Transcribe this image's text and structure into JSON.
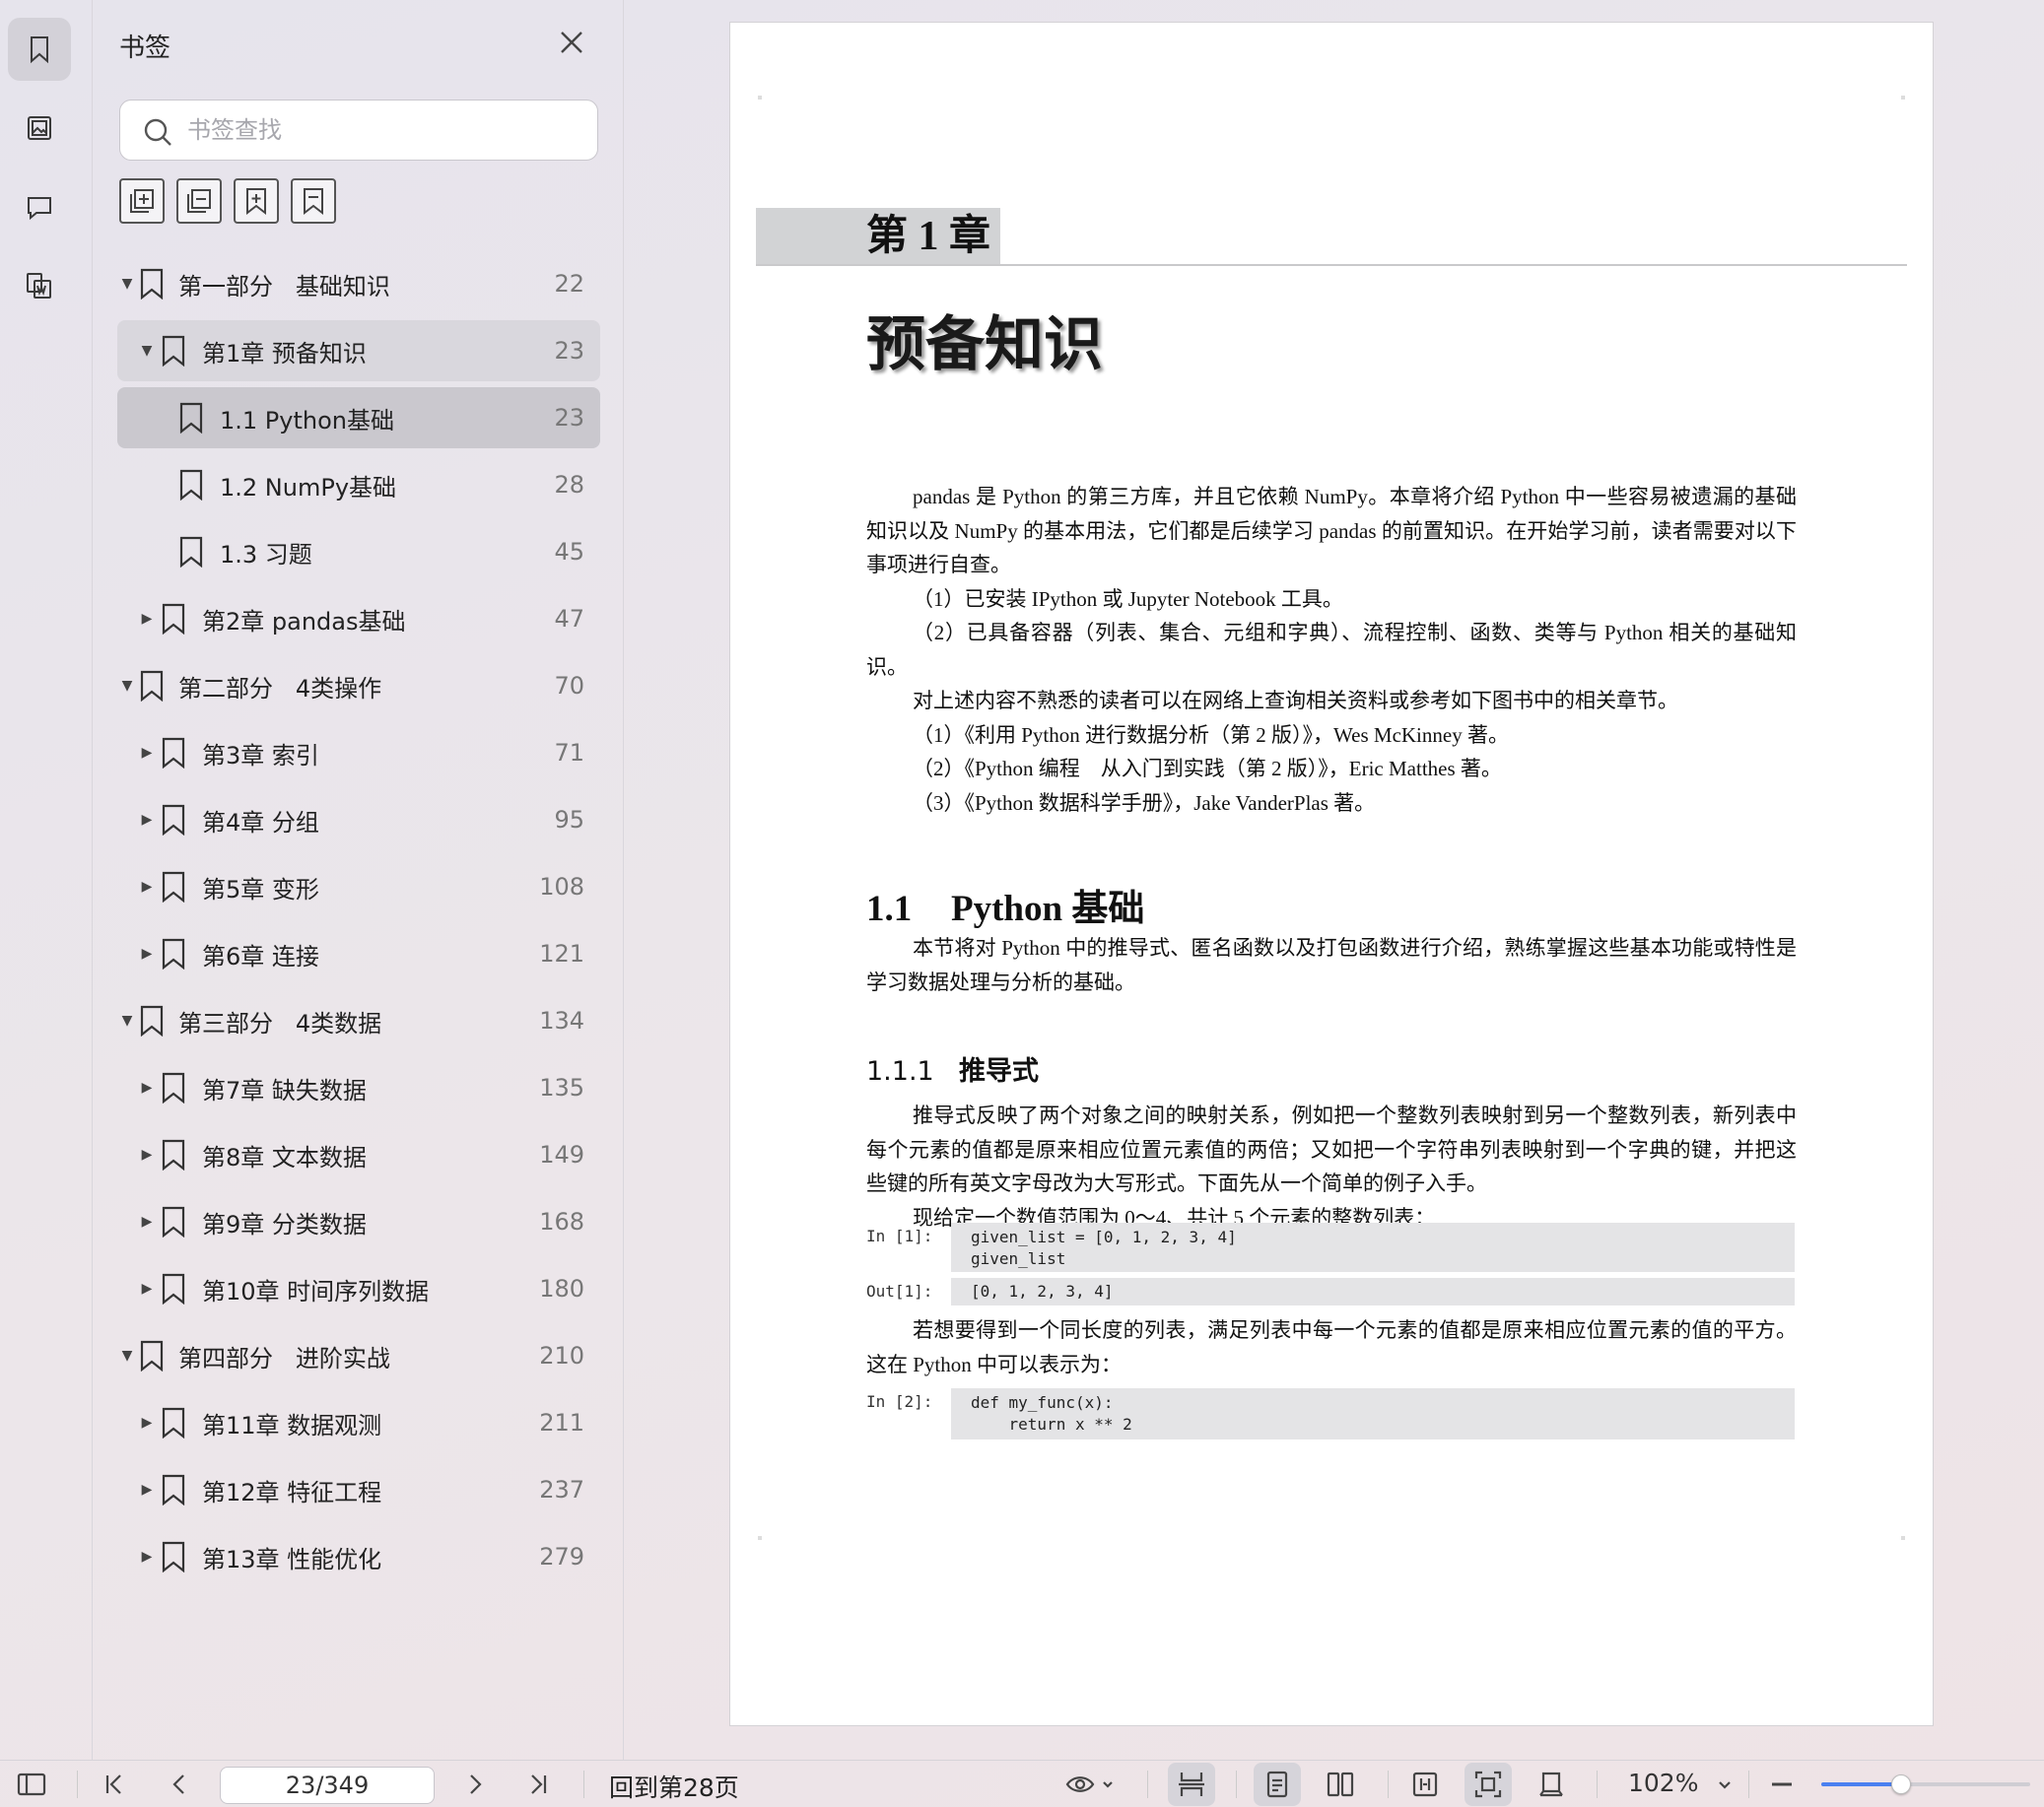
{
  "sidebar_panel": {
    "title": "书签",
    "search_placeholder": "书签查找",
    "bookmarks": [
      {
        "label": "第一部分   基础知识",
        "page": "22",
        "level": 0,
        "expanded": true,
        "state": ""
      },
      {
        "label": "第1章 预备知识",
        "page": "23",
        "level": 1,
        "expanded": true,
        "state": "sel1"
      },
      {
        "label": "1.1 Python基础",
        "page": "23",
        "level": 2,
        "expanded": null,
        "state": "sel2"
      },
      {
        "label": "1.2 NumPy基础",
        "page": "28",
        "level": 2,
        "expanded": null,
        "state": ""
      },
      {
        "label": "1.3 习题",
        "page": "45",
        "level": 2,
        "expanded": null,
        "state": ""
      },
      {
        "label": "第2章 pandas基础",
        "page": "47",
        "level": 1,
        "expanded": false,
        "state": ""
      },
      {
        "label": "第二部分   4类操作",
        "page": "70",
        "level": 0,
        "expanded": true,
        "state": ""
      },
      {
        "label": "第3章 索引",
        "page": "71",
        "level": 1,
        "expanded": false,
        "state": ""
      },
      {
        "label": "第4章 分组",
        "page": "95",
        "level": 1,
        "expanded": false,
        "state": ""
      },
      {
        "label": "第5章 变形",
        "page": "108",
        "level": 1,
        "expanded": false,
        "state": ""
      },
      {
        "label": "第6章 连接",
        "page": "121",
        "level": 1,
        "expanded": false,
        "state": ""
      },
      {
        "label": "第三部分   4类数据",
        "page": "134",
        "level": 0,
        "expanded": true,
        "state": ""
      },
      {
        "label": "第7章 缺失数据",
        "page": "135",
        "level": 1,
        "expanded": false,
        "state": ""
      },
      {
        "label": "第8章 文本数据",
        "page": "149",
        "level": 1,
        "expanded": false,
        "state": ""
      },
      {
        "label": "第9章 分类数据",
        "page": "168",
        "level": 1,
        "expanded": false,
        "state": ""
      },
      {
        "label": "第10章 时间序列数据",
        "page": "180",
        "level": 1,
        "expanded": false,
        "state": ""
      },
      {
        "label": "第四部分   进阶实战",
        "page": "210",
        "level": 0,
        "expanded": true,
        "state": ""
      },
      {
        "label": "第11章 数据观测",
        "page": "211",
        "level": 1,
        "expanded": false,
        "state": ""
      },
      {
        "label": "第12章 特征工程",
        "page": "237",
        "level": 1,
        "expanded": false,
        "state": ""
      },
      {
        "label": "第13章 性能优化",
        "page": "279",
        "level": 1,
        "expanded": false,
        "state": ""
      }
    ]
  },
  "document": {
    "chapter_num": "第 1 章",
    "chapter_title": "预备知识",
    "intro": [
      "pandas 是 Python 的第三方库，并且它依赖 NumPy。本章将介绍 Python 中一些容易被遗漏的基础知识以及 NumPy 的基本用法，它们都是后续学习 pandas 的前置知识。在开始学习前，读者需要对以下事项进行自查。",
      "（1）已安装 IPython 或 Jupyter Notebook 工具。",
      "（2）已具备容器（列表、集合、元组和字典）、流程控制、函数、类等与 Python 相关的基础知识。",
      "对上述内容不熟悉的读者可以在网络上查询相关资料或参考如下图书中的相关章节。",
      "（1）《利用 Python 进行数据分析（第 2 版）》，Wes McKinney 著。",
      "（2）《Python 编程　从入门到实践（第 2 版）》，Eric Matthes 著。",
      "（3）《Python 数据科学手册》，Jake VanderPlas 著。"
    ],
    "sec1_num": "1.1",
    "sec1_title": "Python 基础",
    "sec1_para": "本节将对 Python 中的推导式、匿名函数以及打包函数进行介绍，熟练掌握这些基本功能或特性是学习数据处理与分析的基础。",
    "sec2_num": "1.1.1",
    "sec2_title": "推导式",
    "sec2_paras": [
      "推导式反映了两个对象之间的映射关系，例如把一个整数列表映射到另一个整数列表，新列表中每个元素的值都是原来相应位置元素值的两倍；又如把一个字符串列表映射到一个字典的键，并把这些键的所有英文字母改为大写形式。下面先从一个简单的例子入手。",
      "现给定一个数值范围为 0～4、共计 5 个元素的整数列表："
    ],
    "code1_label": "In [1]:",
    "code1": "given_list = [0, 1, 2, 3, 4]\ngiven_list",
    "out1_label": "Out[1]:",
    "out1": "[0, 1, 2, 3, 4]",
    "para_after": "若想要得到一个同长度的列表，满足列表中每一个元素的值都是原来相应位置元素的值的平方。这在 Python 中可以表示为：",
    "code2_label": "In [2]:",
    "code2": "def my_func(x):\n    return x ** 2"
  },
  "statusbar": {
    "page_indicator": "23/349",
    "goto_label": "回到第28页",
    "zoom_level": "102%",
    "zoom_fraction": 0.38
  }
}
